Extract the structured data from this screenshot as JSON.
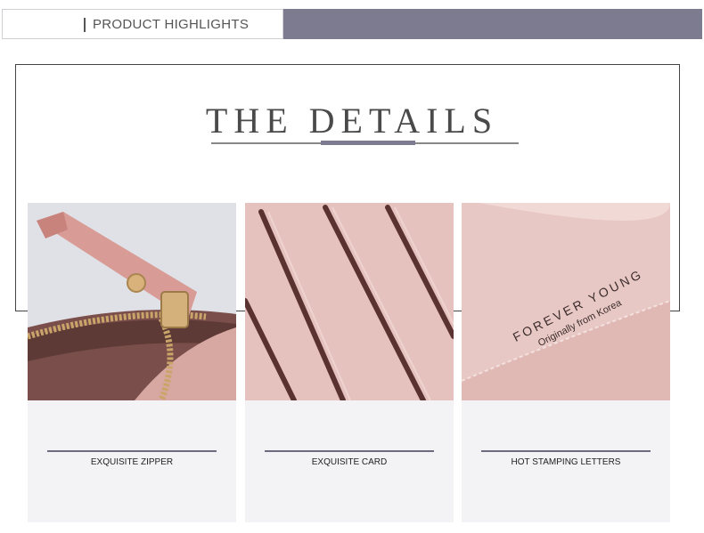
{
  "header": {
    "title": "PRODUCT HIGHLIGHTS"
  },
  "details": {
    "title": "THE DETAILS"
  },
  "cards": [
    {
      "caption": "EXQUISITE ZIPPER"
    },
    {
      "caption": "EXQUISITE CARD"
    },
    {
      "caption": "HOT STAMPING LETTERS",
      "stamp_line1": "FOREVER YOUNG",
      "stamp_line2": "Originally from Korea"
    }
  ],
  "colors": {
    "accent": "#7d7b8f",
    "pink": "#e3b9b6",
    "leather_dark": "#8a5a56"
  }
}
